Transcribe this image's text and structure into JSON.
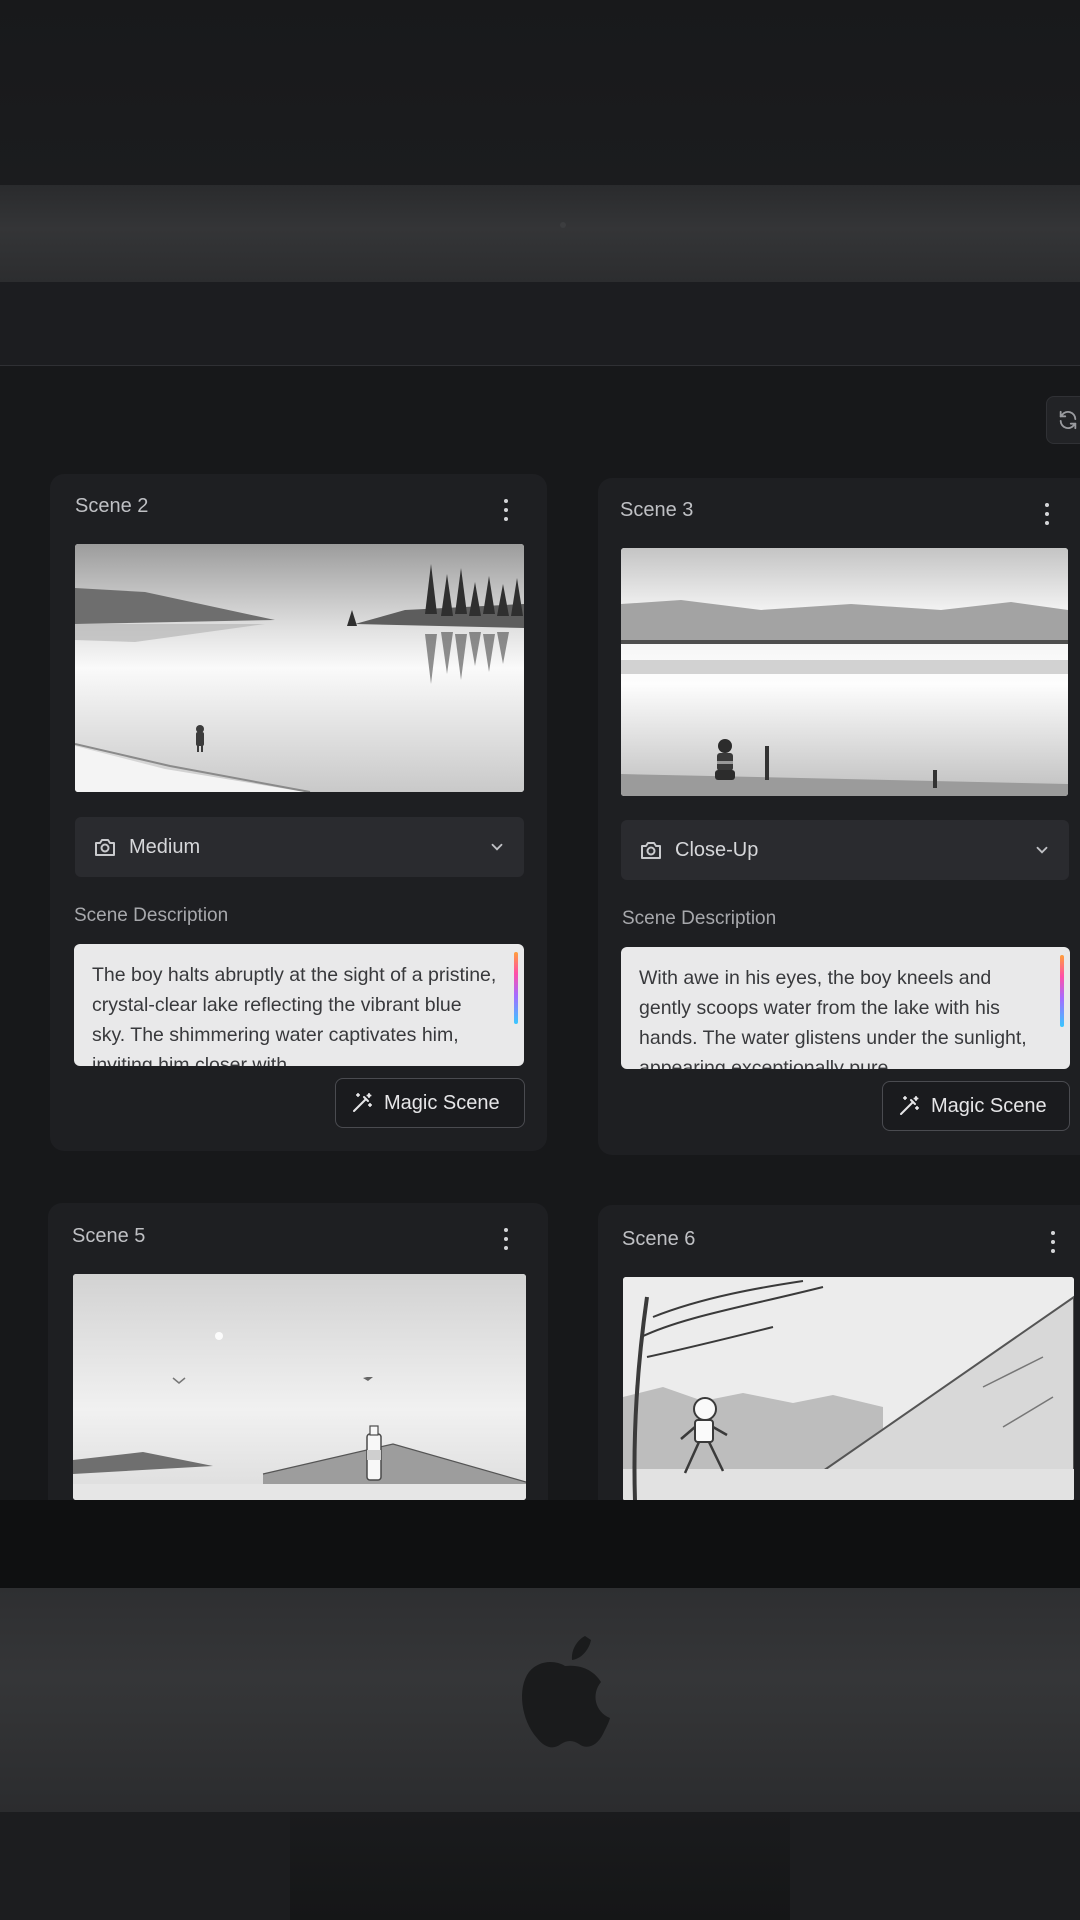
{
  "refresh_icon": "refresh-icon",
  "scenes": [
    {
      "title": "Scene 2",
      "shot": "Medium",
      "description_label": "Scene Description",
      "description": "The boy halts abruptly at the sight of a pristine, crystal-clear lake reflecting the vibrant blue sky. The shimmering water captivates him, inviting him closer with",
      "magic_label": "Magic Scene",
      "image_alt": "boy standing on shore of calm lake with pine island"
    },
    {
      "title": "Scene 3",
      "shot": "Close-Up",
      "description_label": "Scene Description",
      "description": "With awe in his eyes, the boy kneels and gently scoops water from the lake with his hands. The water glistens under the sunlight, appearing exceptionally pure",
      "magic_label": "Magic Scene",
      "image_alt": "boy kneeling at lake edge beside posts"
    },
    {
      "title": "Scene 5",
      "image_alt": "water bottle on hill with birds"
    },
    {
      "title": "Scene 6",
      "image_alt": "boy running under tree near mountain"
    }
  ],
  "colors": {
    "background": "#17181a",
    "card": "#1e1f22",
    "field": "#2a2b2f",
    "description_box": "#e9e9ea"
  }
}
